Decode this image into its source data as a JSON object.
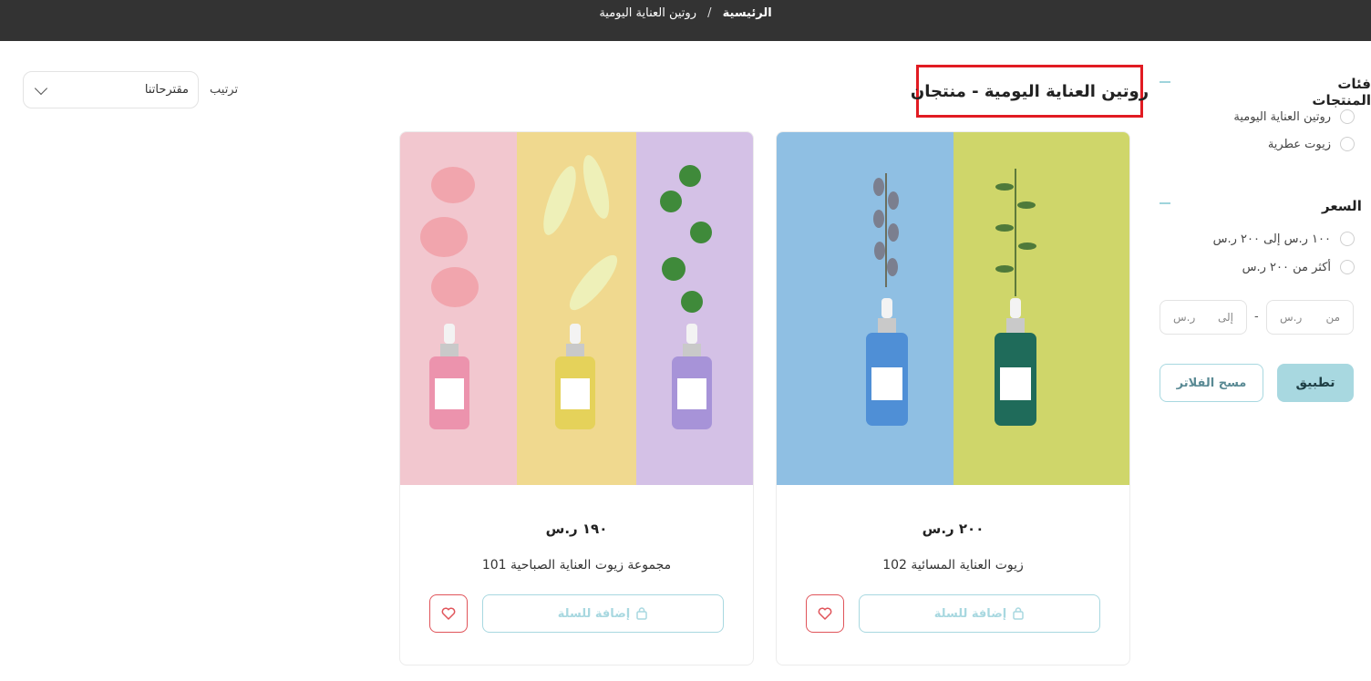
{
  "breadcrumb": {
    "home": "الرئيسية",
    "separator": "/",
    "current": "روتين العناية اليومية"
  },
  "page": {
    "title": "روتين العناية اليومية - منتجان"
  },
  "sort": {
    "label": "ترتيب",
    "value": "مقترحاتنا"
  },
  "filters": {
    "categories_title": "فئات المنتجات",
    "categories": [
      "روتين العناية اليومية",
      "زيوت عطرية"
    ],
    "price_title": "السعر",
    "price_ranges": [
      "١٠٠ ر.س إلى ٢٠٠ ر.س",
      "أكثر من ٢٠٠ ر.س"
    ],
    "from_label": "من",
    "to_label": "إلى",
    "currency": "ر.س",
    "range_dash": "-",
    "apply_label": "تطبيق",
    "clear_label": "مسح الفلاتر"
  },
  "products": [
    {
      "name": "زيوت العناية المسائية 102",
      "price": "٢٠٠ ر.س",
      "cart_label": "إضافة للسلة"
    },
    {
      "name": "مجموعة زيوت العناية الصباحية 101",
      "price": "١٩٠ ر.س",
      "cart_label": "إضافة للسلة"
    }
  ],
  "colors": {
    "topbar": "#333333",
    "accent": "#a8d8e0",
    "wishlist": "#e0545a",
    "highlight": "#e11b22"
  }
}
